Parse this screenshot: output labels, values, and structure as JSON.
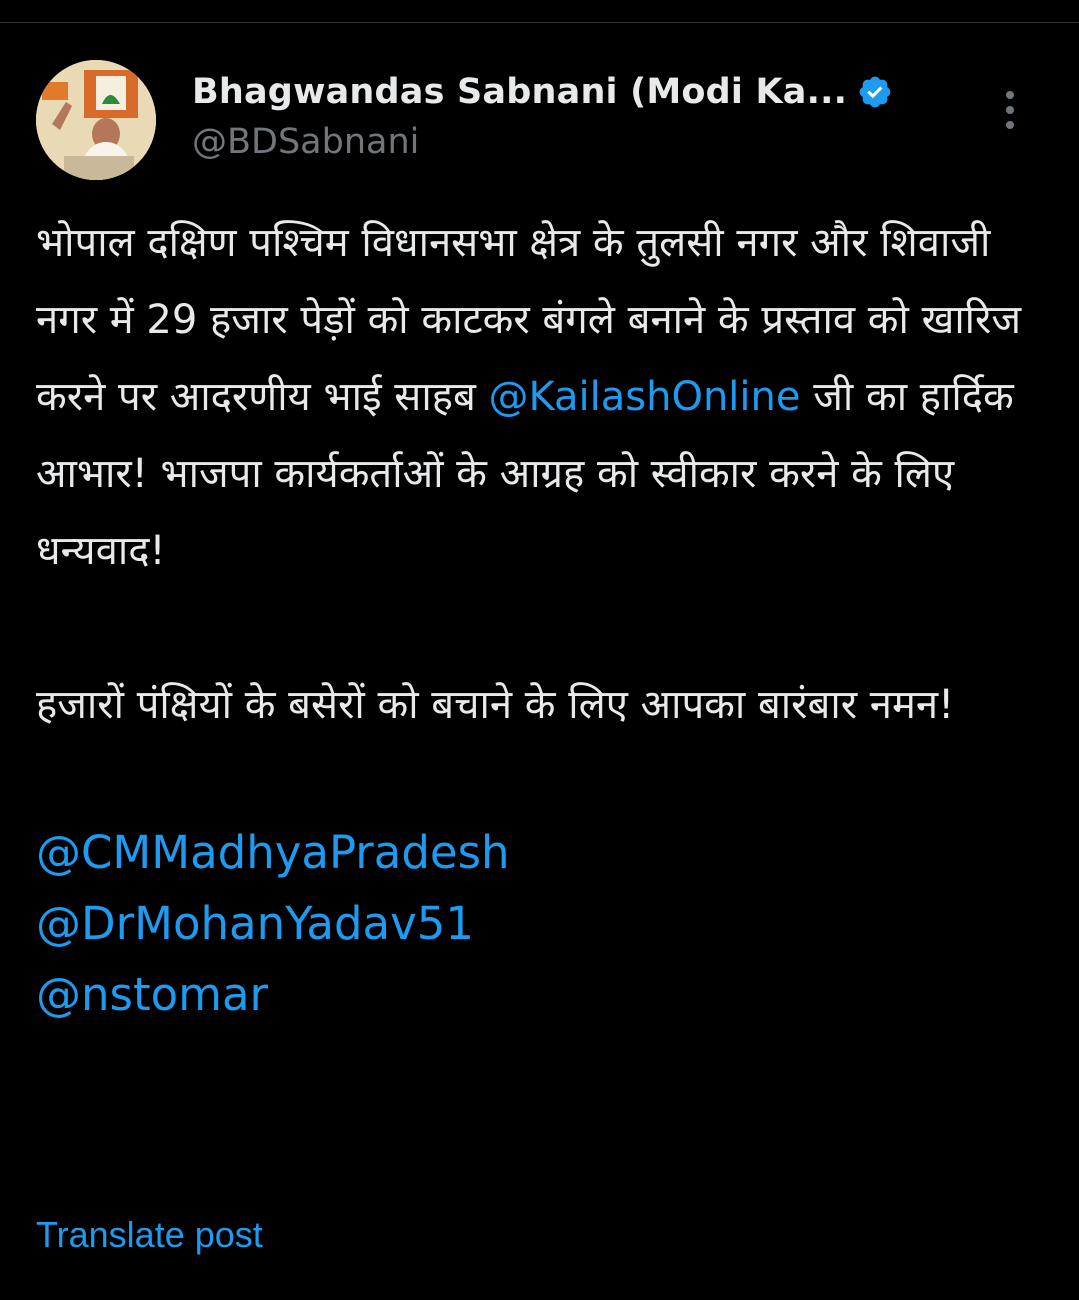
{
  "tweet": {
    "author": {
      "display_name": "Bhagwandas Sabnani (Modi Ka...",
      "handle": "@BDSabnani",
      "verified": true,
      "verified_color": "#1d9bf0"
    },
    "body": {
      "para1": {
        "part1": "भोपाल दक्षिण पश्चिम विधानसभा क्षेत्र के तुलसी नगर और शिवाजी नगर में 29 हजार पेड़ों को काटकर बंगले बनाने के प्रस्ताव को खारिज करने पर आदरणीय भाई साहब ",
        "mention": "@KailashOnline",
        "part2": " जी का हार्दिक आभार! भाजपा कार्यकर्ताओं के आग्रह को स्वीकार करने के लिए धन्यवाद!"
      },
      "para2": "हजारों पंक्षियों के बसेरों को बचाने के लिए आपका बारंबार नमन!",
      "mentions": [
        "@CMMadhyaPradesh",
        "@DrMohanYadav51",
        "@nstomar"
      ]
    },
    "translate_label": "Translate post",
    "more_icon": "more-vertical-icon"
  },
  "colors": {
    "background": "#000000",
    "text": "#e7e9ea",
    "secondary": "#71767b",
    "accent": "#1d9bf0"
  }
}
